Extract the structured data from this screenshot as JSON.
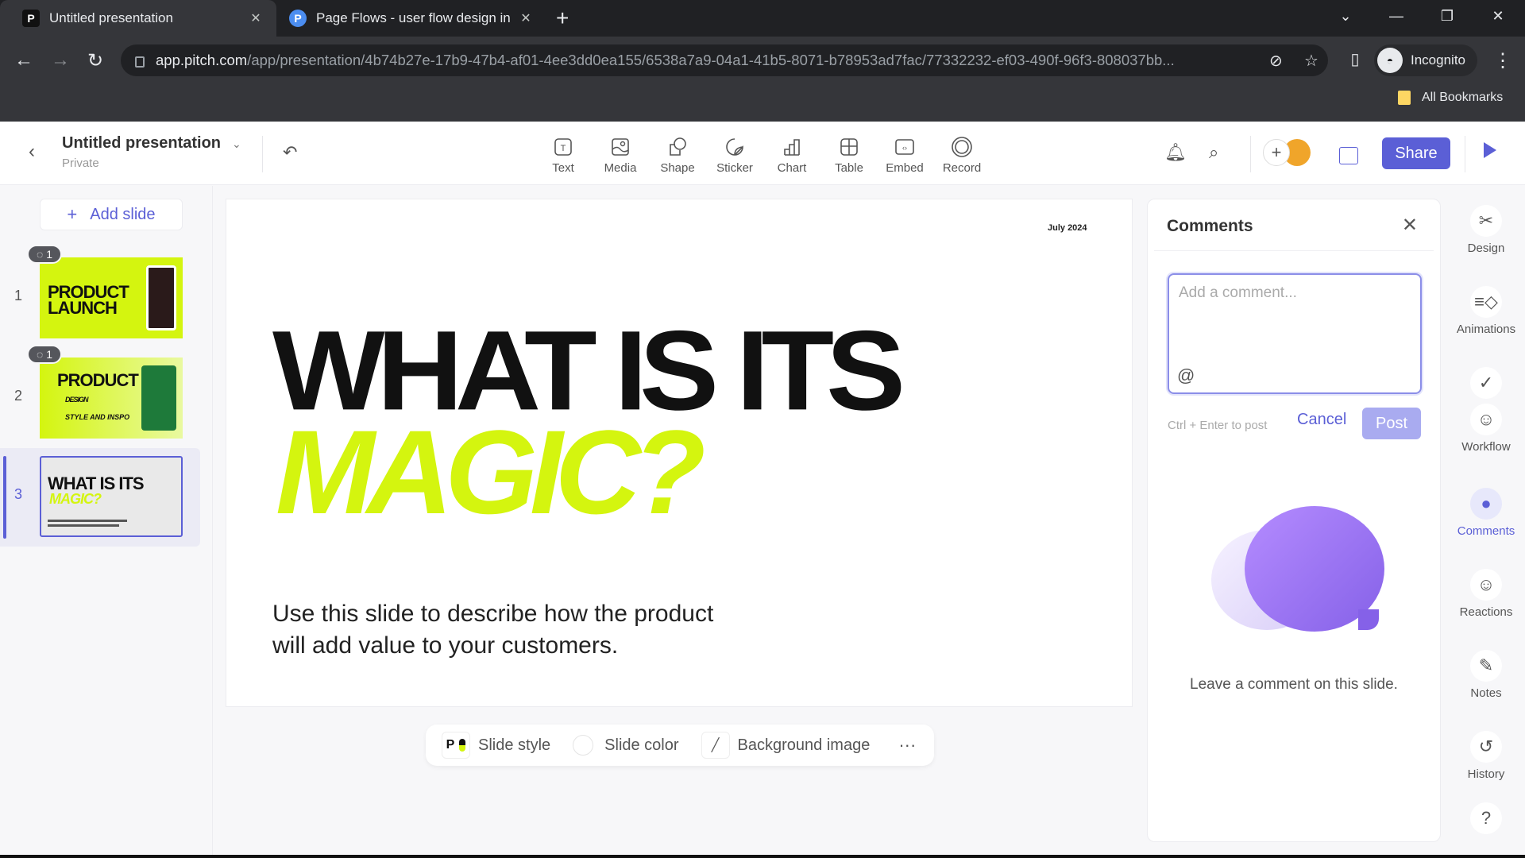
{
  "browser": {
    "tabs": [
      {
        "title": "Untitled presentation",
        "active": true,
        "favicon": "pitch-icon"
      },
      {
        "title": "Page Flows - user flow design in",
        "active": false,
        "favicon": "pageflows-icon"
      }
    ],
    "url_host": "app.pitch.com",
    "url_path": "/app/presentation/4b74b27e-17b9-47b4-af01-4ee3dd0ea155/6538a7a9-04a1-41b5-8071-b78953ad7fac/77332232-ef03-490f-96f3-808037bb...",
    "profile": "Incognito",
    "bookmarks_label": "All Bookmarks"
  },
  "header": {
    "title": "Untitled presentation",
    "subtitle": "Private",
    "tools": [
      {
        "label": "Text",
        "icon": "text-icon"
      },
      {
        "label": "Media",
        "icon": "media-icon"
      },
      {
        "label": "Shape",
        "icon": "shape-icon"
      },
      {
        "label": "Sticker",
        "icon": "sticker-icon"
      },
      {
        "label": "Chart",
        "icon": "chart-icon"
      },
      {
        "label": "Table",
        "icon": "table-icon"
      },
      {
        "label": "Embed",
        "icon": "embed-icon"
      },
      {
        "label": "Record",
        "icon": "record-icon"
      }
    ],
    "share_label": "Share",
    "accent": "#5b5fd6"
  },
  "sidebar": {
    "add_slide_label": "Add slide",
    "slides": [
      {
        "number": "1",
        "comments": "1",
        "title_line1": "PRODUCT",
        "title_line2": "LAUNCH"
      },
      {
        "number": "2",
        "comments": "1",
        "title_line1": "PRODUCT",
        "sub1": "DESIGN",
        "sub2": "STYLE AND INSPO"
      },
      {
        "number": "3",
        "title_line1": "WHAT IS ITS",
        "title_line2": "MAGIC?",
        "selected": true
      }
    ]
  },
  "slide": {
    "date": "July 2024",
    "heading_line1": "WHAT IS ITS",
    "heading_line2": "MAGIC?",
    "body_line1": "Use this slide to describe how the product",
    "body_line2": "will add value to your customers.",
    "highlight_color": "#d4f50f"
  },
  "slide_toolbar": {
    "style_label": "Slide style",
    "color_label": "Slide color",
    "bg_label": "Background image",
    "more": "···"
  },
  "comments": {
    "title": "Comments",
    "placeholder": "Add a comment...",
    "value": "",
    "at": "@",
    "hint": "Ctrl + Enter to post",
    "cancel_label": "Cancel",
    "post_label": "Post",
    "empty_text": "Leave a comment on this slide."
  },
  "rail": {
    "items": [
      {
        "label": "Design",
        "icon": "design-icon"
      },
      {
        "label": "Animations",
        "icon": "animations-icon"
      },
      {
        "label": "Workflow",
        "icon": "workflow-icon"
      },
      {
        "label": "Comments",
        "icon": "comments-icon",
        "active": true
      },
      {
        "label": "Reactions",
        "icon": "reactions-icon"
      },
      {
        "label": "Notes",
        "icon": "notes-icon"
      },
      {
        "label": "History",
        "icon": "history-icon"
      }
    ]
  }
}
